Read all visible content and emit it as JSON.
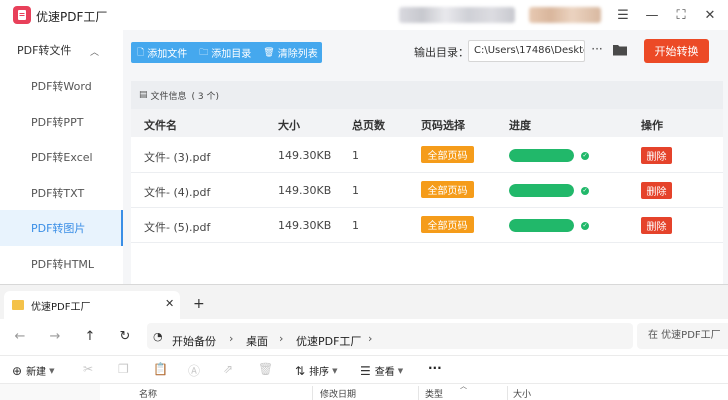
{
  "app": {
    "title": "优速PDF工厂",
    "window_controls": {
      "menu": "☰",
      "minimize": "—",
      "maximize": "⛶",
      "close": "✕"
    }
  },
  "sidebar": {
    "group_label": "PDF转文件",
    "items": [
      {
        "label": "PDF转Word"
      },
      {
        "label": "PDF转PPT"
      },
      {
        "label": "PDF转Excel"
      },
      {
        "label": "PDF转TXT"
      },
      {
        "label": "PDF转图片",
        "active": true
      },
      {
        "label": "PDF转HTML"
      }
    ]
  },
  "toolbar": {
    "add_file": "添加文件",
    "add_dir": "添加目录",
    "clear_list": "清除列表"
  },
  "output": {
    "label": "输出目录：",
    "path": "C:\\Users\\17486\\Deskto",
    "more": "···",
    "start_button": "开始转换"
  },
  "file_panel": {
    "header_title": "文件信息",
    "header_count": "( 3 个)",
    "columns": [
      "文件名",
      "大小",
      "总页数",
      "页码选择",
      "进度",
      "操作"
    ],
    "rows": [
      {
        "name": "文件- (3).pdf",
        "size": "149.30KB",
        "pages": "1",
        "page_select": "全部页码",
        "progress": 1.0,
        "action": "删除"
      },
      {
        "name": "文件- (4).pdf",
        "size": "149.30KB",
        "pages": "1",
        "page_select": "全部页码",
        "progress": 1.0,
        "action": "删除"
      },
      {
        "name": "文件- (5).pdf",
        "size": "149.30KB",
        "pages": "1",
        "page_select": "全部页码",
        "progress": 1.0,
        "action": "删除"
      }
    ]
  },
  "explorer": {
    "tab_title": "优速PDF工厂",
    "tab_close": "✕",
    "tab_new": "+",
    "breadcrumb": [
      "开始备份",
      "桌面",
      "优速PDF工厂"
    ],
    "search_placeholder": "在 优速PDF工厂",
    "commands": {
      "new": "新建",
      "sort": "排序",
      "view": "查看",
      "more": "···"
    },
    "columns": [
      "名称",
      "修改日期",
      "类型",
      "大小"
    ]
  },
  "colors": {
    "accent_blue": "#45a8ee",
    "start_red": "#ec4a26",
    "page_orange": "#f59c1a",
    "progress_green": "#21b86a",
    "delete_red": "#e5432b",
    "logo_pink": "#e8405a"
  },
  "icons": {
    "logo": "pdf-logo-icon",
    "folder": "folder-icon",
    "check": "check-circle-icon"
  }
}
